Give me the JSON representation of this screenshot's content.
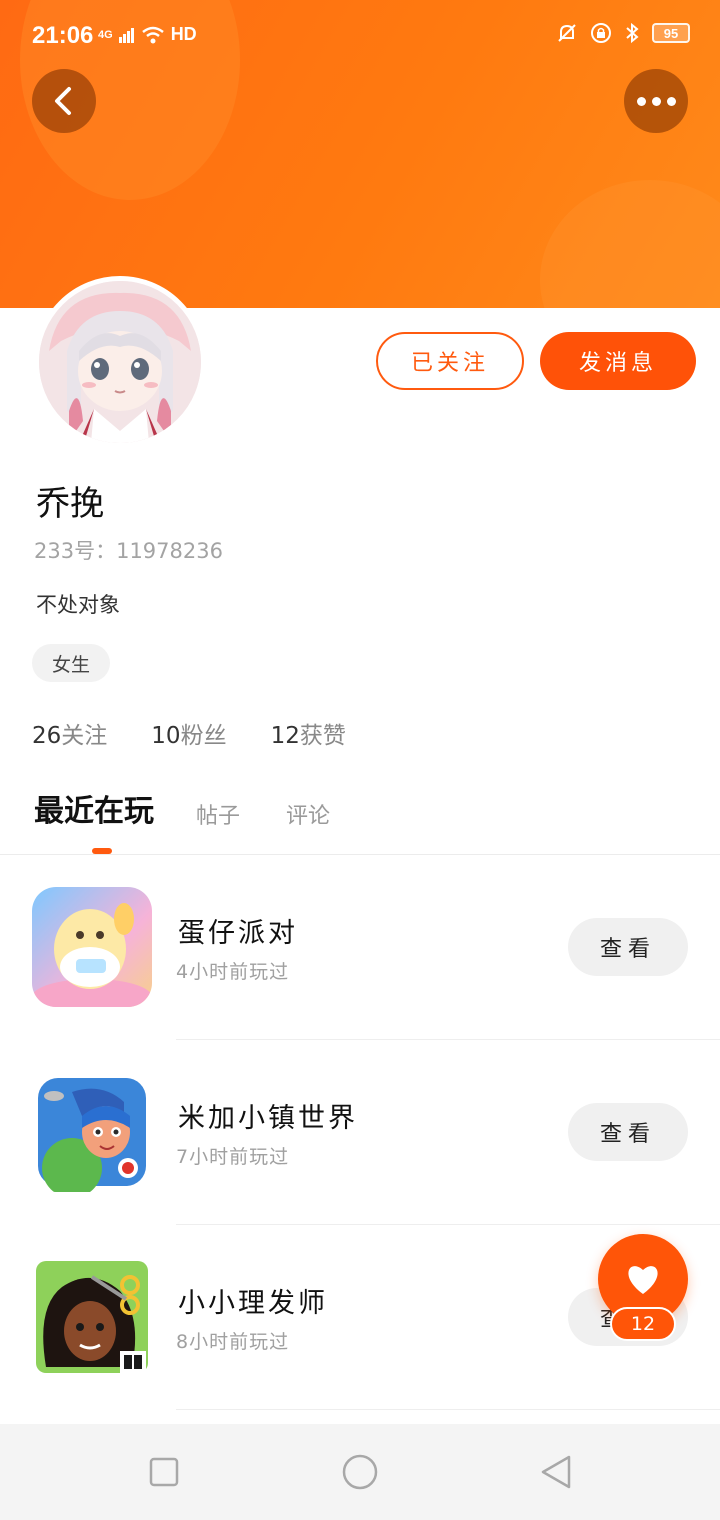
{
  "status_bar": {
    "time": "21:06",
    "network": "4G",
    "hd": "HD",
    "battery": "95"
  },
  "profile": {
    "name": "乔挽",
    "uid": "233号：11978236",
    "bio": "不处对象",
    "gender_tag": "女生",
    "follow_label": "已关注",
    "message_label": "发消息",
    "stats": {
      "following_count": "26",
      "following_label": "关注",
      "fans_count": "10",
      "fans_label": "粉丝",
      "likes_count": "12",
      "likes_label": "获赞"
    }
  },
  "tabs": [
    {
      "label": "最近在玩"
    },
    {
      "label": "帖子"
    },
    {
      "label": "评论"
    }
  ],
  "games": [
    {
      "name": "蛋仔派对",
      "time": "4小时前玩过",
      "action": "查看",
      "icon": "eggy-party-icon"
    },
    {
      "name": "米加小镇世界",
      "time": "7小时前玩过",
      "action": "查看",
      "icon": "toca-world-icon"
    },
    {
      "name": "小小理发师",
      "time": "8小时前玩过",
      "action": "查看",
      "icon": "hair-salon-icon"
    }
  ],
  "like_fab": {
    "count": "12",
    "icon": "heart-icon"
  },
  "colors": {
    "accent": "#ff5a0f",
    "header": "#ff7210"
  }
}
